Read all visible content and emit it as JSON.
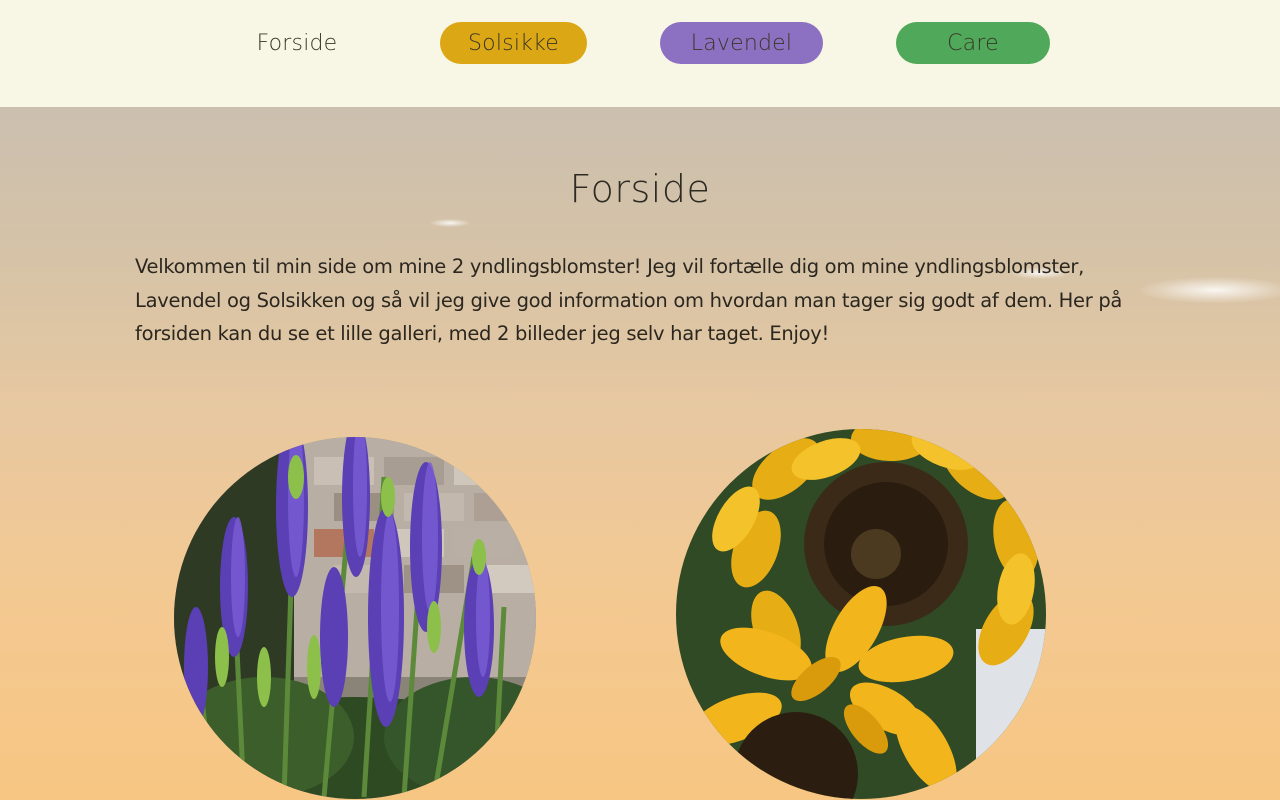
{
  "nav": {
    "items": [
      {
        "label": "Forside",
        "color": null
      },
      {
        "label": "Solsikke",
        "color": "#dba714"
      },
      {
        "label": "Lavendel",
        "color": "#8c71c2"
      },
      {
        "label": "Care",
        "color": "#50a85a"
      }
    ]
  },
  "main": {
    "title": "Forside",
    "intro": "Velkommen til min side om mine 2 yndlingsblomster! Jeg vil fortælle dig om mine yndlingsblomster, Lavendel og Solsikken og så vil jeg give god information om hvordan man tager sig godt af dem. Her på forsiden kan du se et lille galleri, med 2 billeder jeg selv har taget. Enjoy!"
  },
  "gallery": {
    "images": [
      {
        "subject": "lavender-photo"
      },
      {
        "subject": "sunflower-photo"
      }
    ]
  }
}
